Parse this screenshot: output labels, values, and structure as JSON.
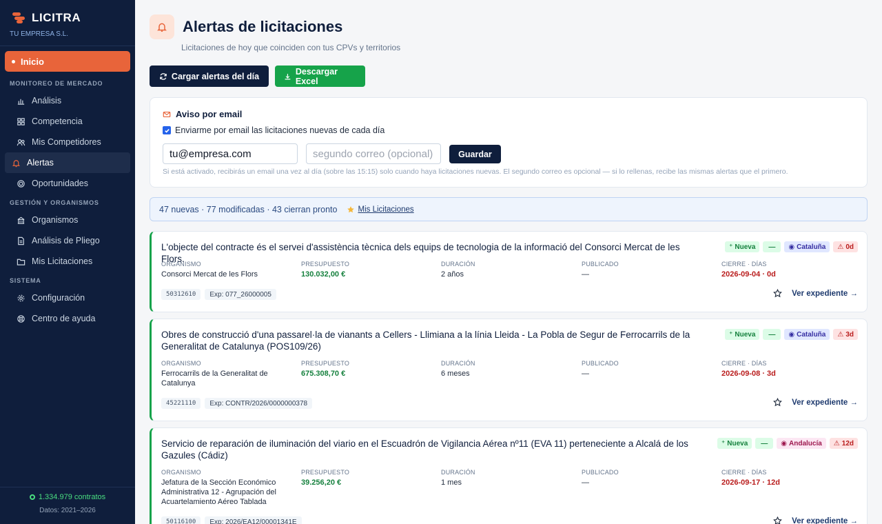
{
  "app": {
    "name": "LICITRA",
    "company": "TU EMPRESA S.L."
  },
  "nav": {
    "home": "Inicio",
    "sections": [
      {
        "title": "MONITOREO DE MERCADO",
        "items": [
          "Análisis",
          "Competencia",
          "Mis Competidores",
          "Alertas",
          "Oportunidades"
        ]
      },
      {
        "title": "GESTIÓN Y ORGANISMOS",
        "items": [
          "Organismos",
          "Análisis de Pliego",
          "Mis Licitaciones"
        ]
      },
      {
        "title": "SISTEMA",
        "items": [
          "Configuración",
          "Centro de ayuda"
        ]
      }
    ],
    "selected": "Alertas"
  },
  "footer": {
    "contracts": "1.334.979 contratos",
    "years": "Datos: 2021–2026"
  },
  "page": {
    "title": "Alertas de licitaciones",
    "subtitle": "Licitaciones de hoy que coinciden con tus CPVs y territorios",
    "load_button": "Cargar alertas del día",
    "excel_button": "Descargar Excel"
  },
  "email": {
    "title": "Aviso por email",
    "checkbox_label": "Enviarme por email las licitaciones nuevas de cada día",
    "checked": true,
    "email1_value": "tu@empresa.com",
    "email2_placeholder": "segundo correo (opcional)",
    "save_label": "Guardar",
    "help": "Si está activado, recibirás un email una vez al día (sobre las 15:15) solo cuando haya licitaciones nuevas. El segundo correo es opcional — si lo rellenas, recibe las mismas alertas que el primero."
  },
  "summary": {
    "text": "47 nuevas · 77 modificadas · 43 cierran pronto",
    "link": "Mis Licitaciones"
  },
  "labels": {
    "organismo": "ORGANISMO",
    "presupuesto": "PRESUPUESTO",
    "duracion": "DURACIÓN",
    "publicado": "PUBLICADO",
    "cierre": "CIERRE · DÍAS",
    "ver": "Ver expediente →"
  },
  "tenders": [
    {
      "title": "L'objecte del contracte és el servei d'assistència tècnica dels equips de tecnologia de la informació del Consorci Mercat de les Flors.",
      "badge_new": "Nueva",
      "badge_dash": "—",
      "region": "Cataluña",
      "days_badge": "0d",
      "organismo": "Consorci Mercat de les Flors",
      "presupuesto": "130.032,00 €",
      "duracion": "2 años",
      "publicado": "—",
      "cierre": "2026-09-04 · 0d",
      "cpv": "50312610",
      "exp": "Exp: 077_26000005"
    },
    {
      "title": "Obres de construcció d'una passarel·la de vianants a Cellers - Llimiana a la línia Lleida - La Pobla de Segur de Ferrocarrils de la Generalitat de Catalunya (POS109/26)",
      "badge_new": "Nueva",
      "badge_dash": "—",
      "region": "Cataluña",
      "days_badge": "3d",
      "organismo": "Ferrocarrils de la Generalitat de Catalunya",
      "presupuesto": "675.308,70 €",
      "duracion": "6 meses",
      "publicado": "—",
      "cierre": "2026-09-08 · 3d",
      "cpv": "45221110",
      "exp": "Exp: CONTR/2026/0000000378"
    },
    {
      "title": "Servicio de reparación de iluminación del viario en el Escuadrón de Vigilancia Aérea nº11 (EVA 11) perteneciente a Alcalá de los Gazules (Cádiz)",
      "badge_new": "Nueva",
      "badge_dash": "—",
      "region": "Andalucía",
      "days_badge": "12d",
      "organismo": "Jefatura de la Sección Económico Administrativa 12 - Agrupación del Acuartelamiento Aéreo Tablada",
      "presupuesto": "39.256,20 €",
      "duracion": "1 mes",
      "publicado": "—",
      "cierre": "2026-09-17 · 12d",
      "cpv": "50116100",
      "exp": "Exp: 2026/EA12/00001341E"
    }
  ],
  "colors": {
    "sidebar": "#0f1e3c",
    "accent": "#e8643a",
    "green": "#16a34a"
  }
}
